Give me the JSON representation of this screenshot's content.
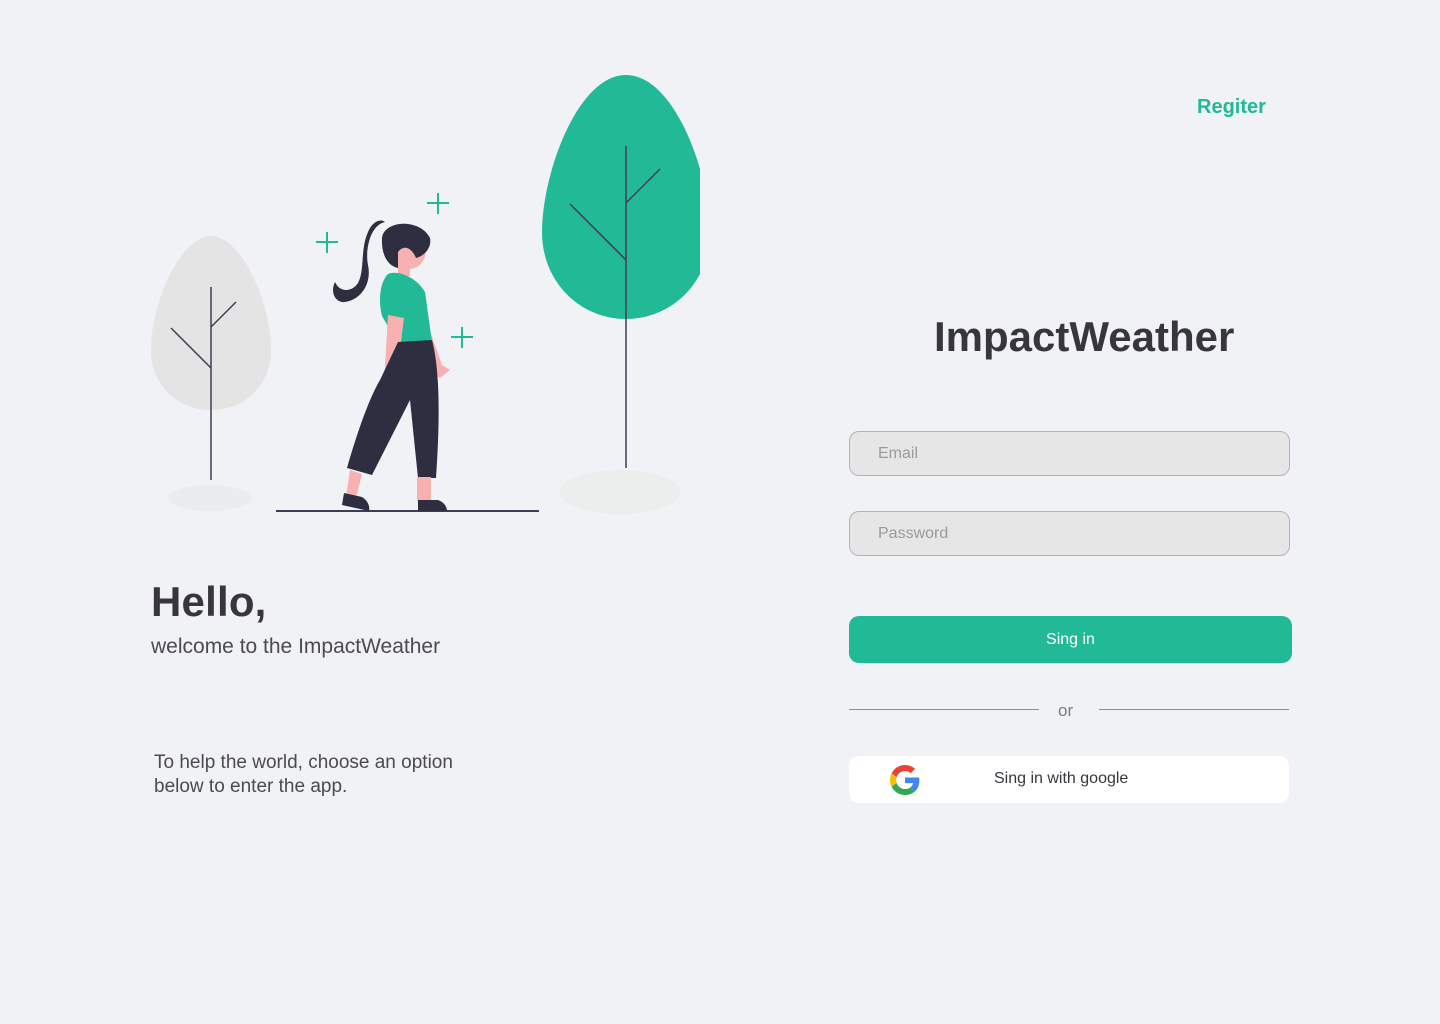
{
  "header": {
    "register_label": "Regiter"
  },
  "hero": {
    "title": "Hello,",
    "subtitle": "welcome to the ImpactWeather",
    "help_text": "To help the world, choose an option below to enter the app."
  },
  "login": {
    "brand_title": "ImpactWeather",
    "email_placeholder": "Email",
    "password_placeholder": "Password",
    "signin_label": "Sing in",
    "divider_label": "or",
    "google_label": "Sing in with google"
  },
  "colors": {
    "accent": "#22b996",
    "background": "#f0f2f5",
    "dark_text": "#38363d"
  },
  "icons": {
    "illustration": "woman-walking-between-trees-illustration",
    "google": "google-g-icon"
  }
}
